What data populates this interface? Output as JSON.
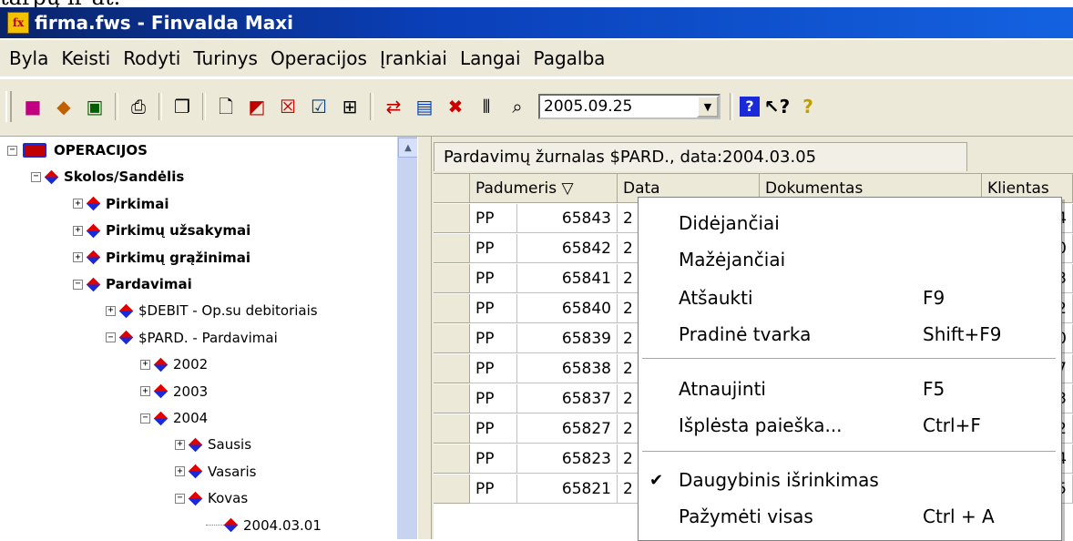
{
  "above_text": "tarpų ir at.",
  "window": {
    "title": "firma.fws - Finvalda Maxi",
    "icon": "finvalda-app-icon"
  },
  "menu": [
    "Byla",
    "Keisti",
    "Rodyti",
    "Turinys",
    "Operacijos",
    "Įrankiai",
    "Langai",
    "Pagalba"
  ],
  "toolbar": {
    "date_value": "2005.09.25",
    "icons": [
      "new-record-icon",
      "open-icon",
      "save-icon",
      "print-icon",
      "copy-icon",
      "blank-page-icon",
      "import-icon",
      "delete-icon",
      "edit-icon",
      "grid-view-icon",
      "transfer-icon",
      "form-icon",
      "cancel-icon",
      "columns-icon",
      "preview-icon",
      "help-icon",
      "context-help-icon",
      "question-icon"
    ]
  },
  "tree": {
    "nodes": [
      {
        "label": "OPERACIJOS",
        "expander": "−",
        "bold": true,
        "root": true
      },
      {
        "label": "Skolos/Sandėlis",
        "expander": "−",
        "bold": true
      },
      {
        "label": "Pirkimai",
        "expander": "+",
        "bold": true
      },
      {
        "label": "Pirkimų užsakymai",
        "expander": "+",
        "bold": true
      },
      {
        "label": "Pirkimų grąžinimai",
        "expander": "+",
        "bold": true
      },
      {
        "label": "Pardavimai",
        "expander": "−",
        "bold": true
      },
      {
        "label": "$DEBIT - Op.su debitoriais",
        "expander": "+",
        "bold": false
      },
      {
        "label": "$PARD. - Pardavimai",
        "expander": "−",
        "bold": false
      },
      {
        "label": "2002",
        "expander": "+",
        "bold": false
      },
      {
        "label": "2003",
        "expander": "+",
        "bold": false
      },
      {
        "label": "2004",
        "expander": "−",
        "bold": false
      },
      {
        "label": "Sausis",
        "expander": "+",
        "bold": false
      },
      {
        "label": "Vasaris",
        "expander": "+",
        "bold": false
      },
      {
        "label": "Kovas",
        "expander": "−",
        "bold": false
      },
      {
        "label": "2004.03.01",
        "expander": "",
        "bold": false
      }
    ]
  },
  "journal": {
    "title": "Pardavimų žurnalas $PARD., data:2004.03.05",
    "columns": [
      "Padumeris ▽",
      "Data",
      "Dokumentas",
      "Klientas"
    ],
    "rows": [
      {
        "prefix": "PP",
        "number": "65843",
        "date": "2",
        "client": "4"
      },
      {
        "prefix": "PP",
        "number": "65842",
        "date": "2",
        "client": "0"
      },
      {
        "prefix": "PP",
        "number": "65841",
        "date": "2",
        "client": "3"
      },
      {
        "prefix": "PP",
        "number": "65840",
        "date": "2",
        "client": "2"
      },
      {
        "prefix": "PP",
        "number": "65839",
        "date": "2",
        "client": "0"
      },
      {
        "prefix": "PP",
        "number": "65838",
        "date": "2",
        "client": "7"
      },
      {
        "prefix": "PP",
        "number": "65837",
        "date": "2",
        "client": "3"
      },
      {
        "prefix": "PP",
        "number": "65827",
        "date": "2",
        "client": "2"
      },
      {
        "prefix": "PP",
        "number": "65823",
        "date": "2",
        "client": "4"
      },
      {
        "prefix": "PP",
        "number": "65821",
        "date": "2",
        "client": "5"
      }
    ]
  },
  "context_menu": {
    "items": [
      {
        "label": "Didėjančiai",
        "shortcut": "",
        "checked": false
      },
      {
        "label": "Mažėjančiai",
        "shortcut": "",
        "checked": false
      },
      {
        "label": "Atšaukti",
        "shortcut": "F9",
        "checked": false
      },
      {
        "label": "Pradinė tvarka",
        "shortcut": "Shift+F9",
        "checked": false
      },
      {
        "label": "Atnaujinti",
        "shortcut": "F5",
        "checked": false
      },
      {
        "label": "Išplėsta paieška...",
        "shortcut": "Ctrl+F",
        "checked": false
      },
      {
        "label": "Daugybinis išrinkimas",
        "shortcut": "",
        "checked": true
      },
      {
        "label": "Pažymėti visas",
        "shortcut": "Ctrl + A",
        "checked": false
      }
    ],
    "check_glyph": "✔"
  }
}
